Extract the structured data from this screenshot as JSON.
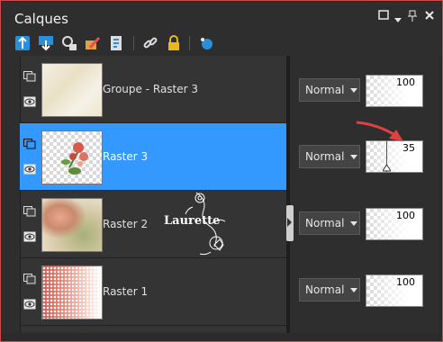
{
  "panel": {
    "title": "Calques"
  },
  "layers": [
    {
      "name": "Groupe - Raster 3",
      "blend": "Normal",
      "opacity": "100",
      "selected": false,
      "thumb": "group"
    },
    {
      "name": "Raster 3",
      "blend": "Normal",
      "opacity": "35",
      "selected": true,
      "thumb": "roses"
    },
    {
      "name": "Raster 2",
      "blend": "Normal",
      "opacity": "100",
      "selected": false,
      "thumb": "blur"
    },
    {
      "name": "Raster 1",
      "blend": "Normal",
      "opacity": "100",
      "selected": false,
      "thumb": "pattern"
    }
  ],
  "watermark": {
    "text": "Laurette"
  },
  "colors": {
    "selection": "#3399ff",
    "annotation_arrow": "#e04040",
    "frame_border": "#d04a4a"
  }
}
